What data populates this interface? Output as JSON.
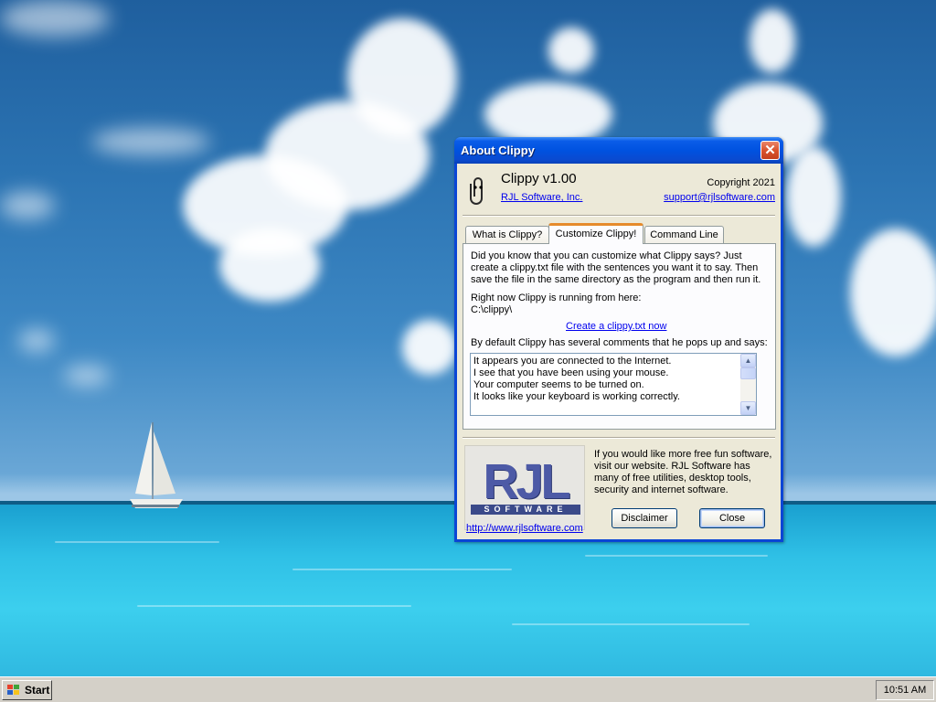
{
  "dialog": {
    "title": "About Clippy",
    "close_glyph": "✕",
    "app_name": "Clippy v1.00",
    "company_link": "RJL Software, Inc.",
    "copyright": "Copyright 2021",
    "support_link": "support@rjlsoftware.com",
    "icon": "paperclip-icon"
  },
  "tabs": [
    {
      "label": "What is Clippy?",
      "active": false
    },
    {
      "label": "Customize Clippy!",
      "active": true
    },
    {
      "label": "Command Line",
      "active": false
    }
  ],
  "customize_panel": {
    "intro": "Did you know that you can customize what Clippy says? Just create a clippy.txt file with the sentences you want it to say. Then save the file in the same directory as the program and then run it.",
    "running_from_label": "Right now Clippy is running from here:",
    "running_path": "C:\\clippy\\",
    "create_link": "Create a clippy.txt now",
    "default_comments_label": "By default Clippy has several comments that he pops up and says:",
    "comments": [
      "It appears you are connected to the Internet.",
      "I see that you have been using your mouse.",
      "Your computer seems to be turned on.",
      "It looks like your keyboard is working correctly."
    ]
  },
  "footer": {
    "logo_text": "RJL",
    "logo_subtext": "SOFTWARE",
    "site_link": "http://www.rjlsoftware.com",
    "promo": "If you would like more free fun software, visit our website. RJL Software has many of free utilities, desktop tools, security and internet software.",
    "disclaimer_button": "Disclaimer",
    "close_button": "Close"
  },
  "taskbar": {
    "start_label": "Start",
    "clock": "10:51 AM"
  },
  "colors": {
    "title_blue": "#0a5ce8",
    "close_red": "#d9532e",
    "dialog_face": "#ece9d8",
    "link": "#0000ee",
    "tab_highlight": "#e68b2c"
  }
}
